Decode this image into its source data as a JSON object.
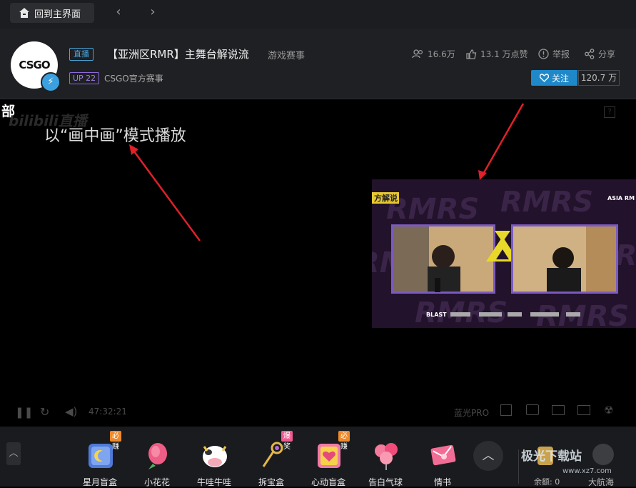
{
  "topbar": {
    "home_label": "回到主界面",
    "back_icon": "chevron-left-icon",
    "forward_icon": "chevron-right-icon"
  },
  "header": {
    "avatar_text": "CSGO",
    "live_tag": "直播",
    "title": "【亚洲区RMR】主舞台解说流",
    "category": "游戏赛事",
    "up_tag": "UP 22",
    "uploader": "CSGO官方赛事",
    "viewers": "16.6万",
    "likes": "13.1 万点赞",
    "report": "举报",
    "share": "分享",
    "follow_label": "关注",
    "follower_count": "120.7 万"
  },
  "player": {
    "side_char": "部",
    "watermark": "bilibili直播",
    "caption": "以“画中画”模式播放",
    "pip": {
      "banner": "方解说",
      "corner": "ASIA RM",
      "brand": "BLAST"
    },
    "time": "47:32:21",
    "quality": "蓝光PRO"
  },
  "gifts": [
    {
      "name": "星月盲盒",
      "badge": "必赚",
      "badge_color": "#f08a2a"
    },
    {
      "name": "小花花",
      "badge": "",
      "badge_color": ""
    },
    {
      "name": "牛哇牛哇",
      "badge": "",
      "badge_color": ""
    },
    {
      "name": "拆宝盒",
      "badge": "爆奖",
      "badge_color": "#ef5a8f"
    },
    {
      "name": "心动盲盒",
      "badge": "必赚",
      "badge_color": "#f08a2a"
    },
    {
      "name": "告白气球",
      "badge": "",
      "badge_color": ""
    },
    {
      "name": "情书",
      "badge": "",
      "badge_color": ""
    }
  ],
  "wallet": {
    "balance": "余额: 0",
    "captain": "大航海"
  },
  "site_logo": {
    "name": "极光下载站",
    "url": "www.xz7.com"
  },
  "colors": {
    "accent": "#1e88c9",
    "arrow": "#e0202a",
    "up_tag": "#9f7fe6"
  }
}
